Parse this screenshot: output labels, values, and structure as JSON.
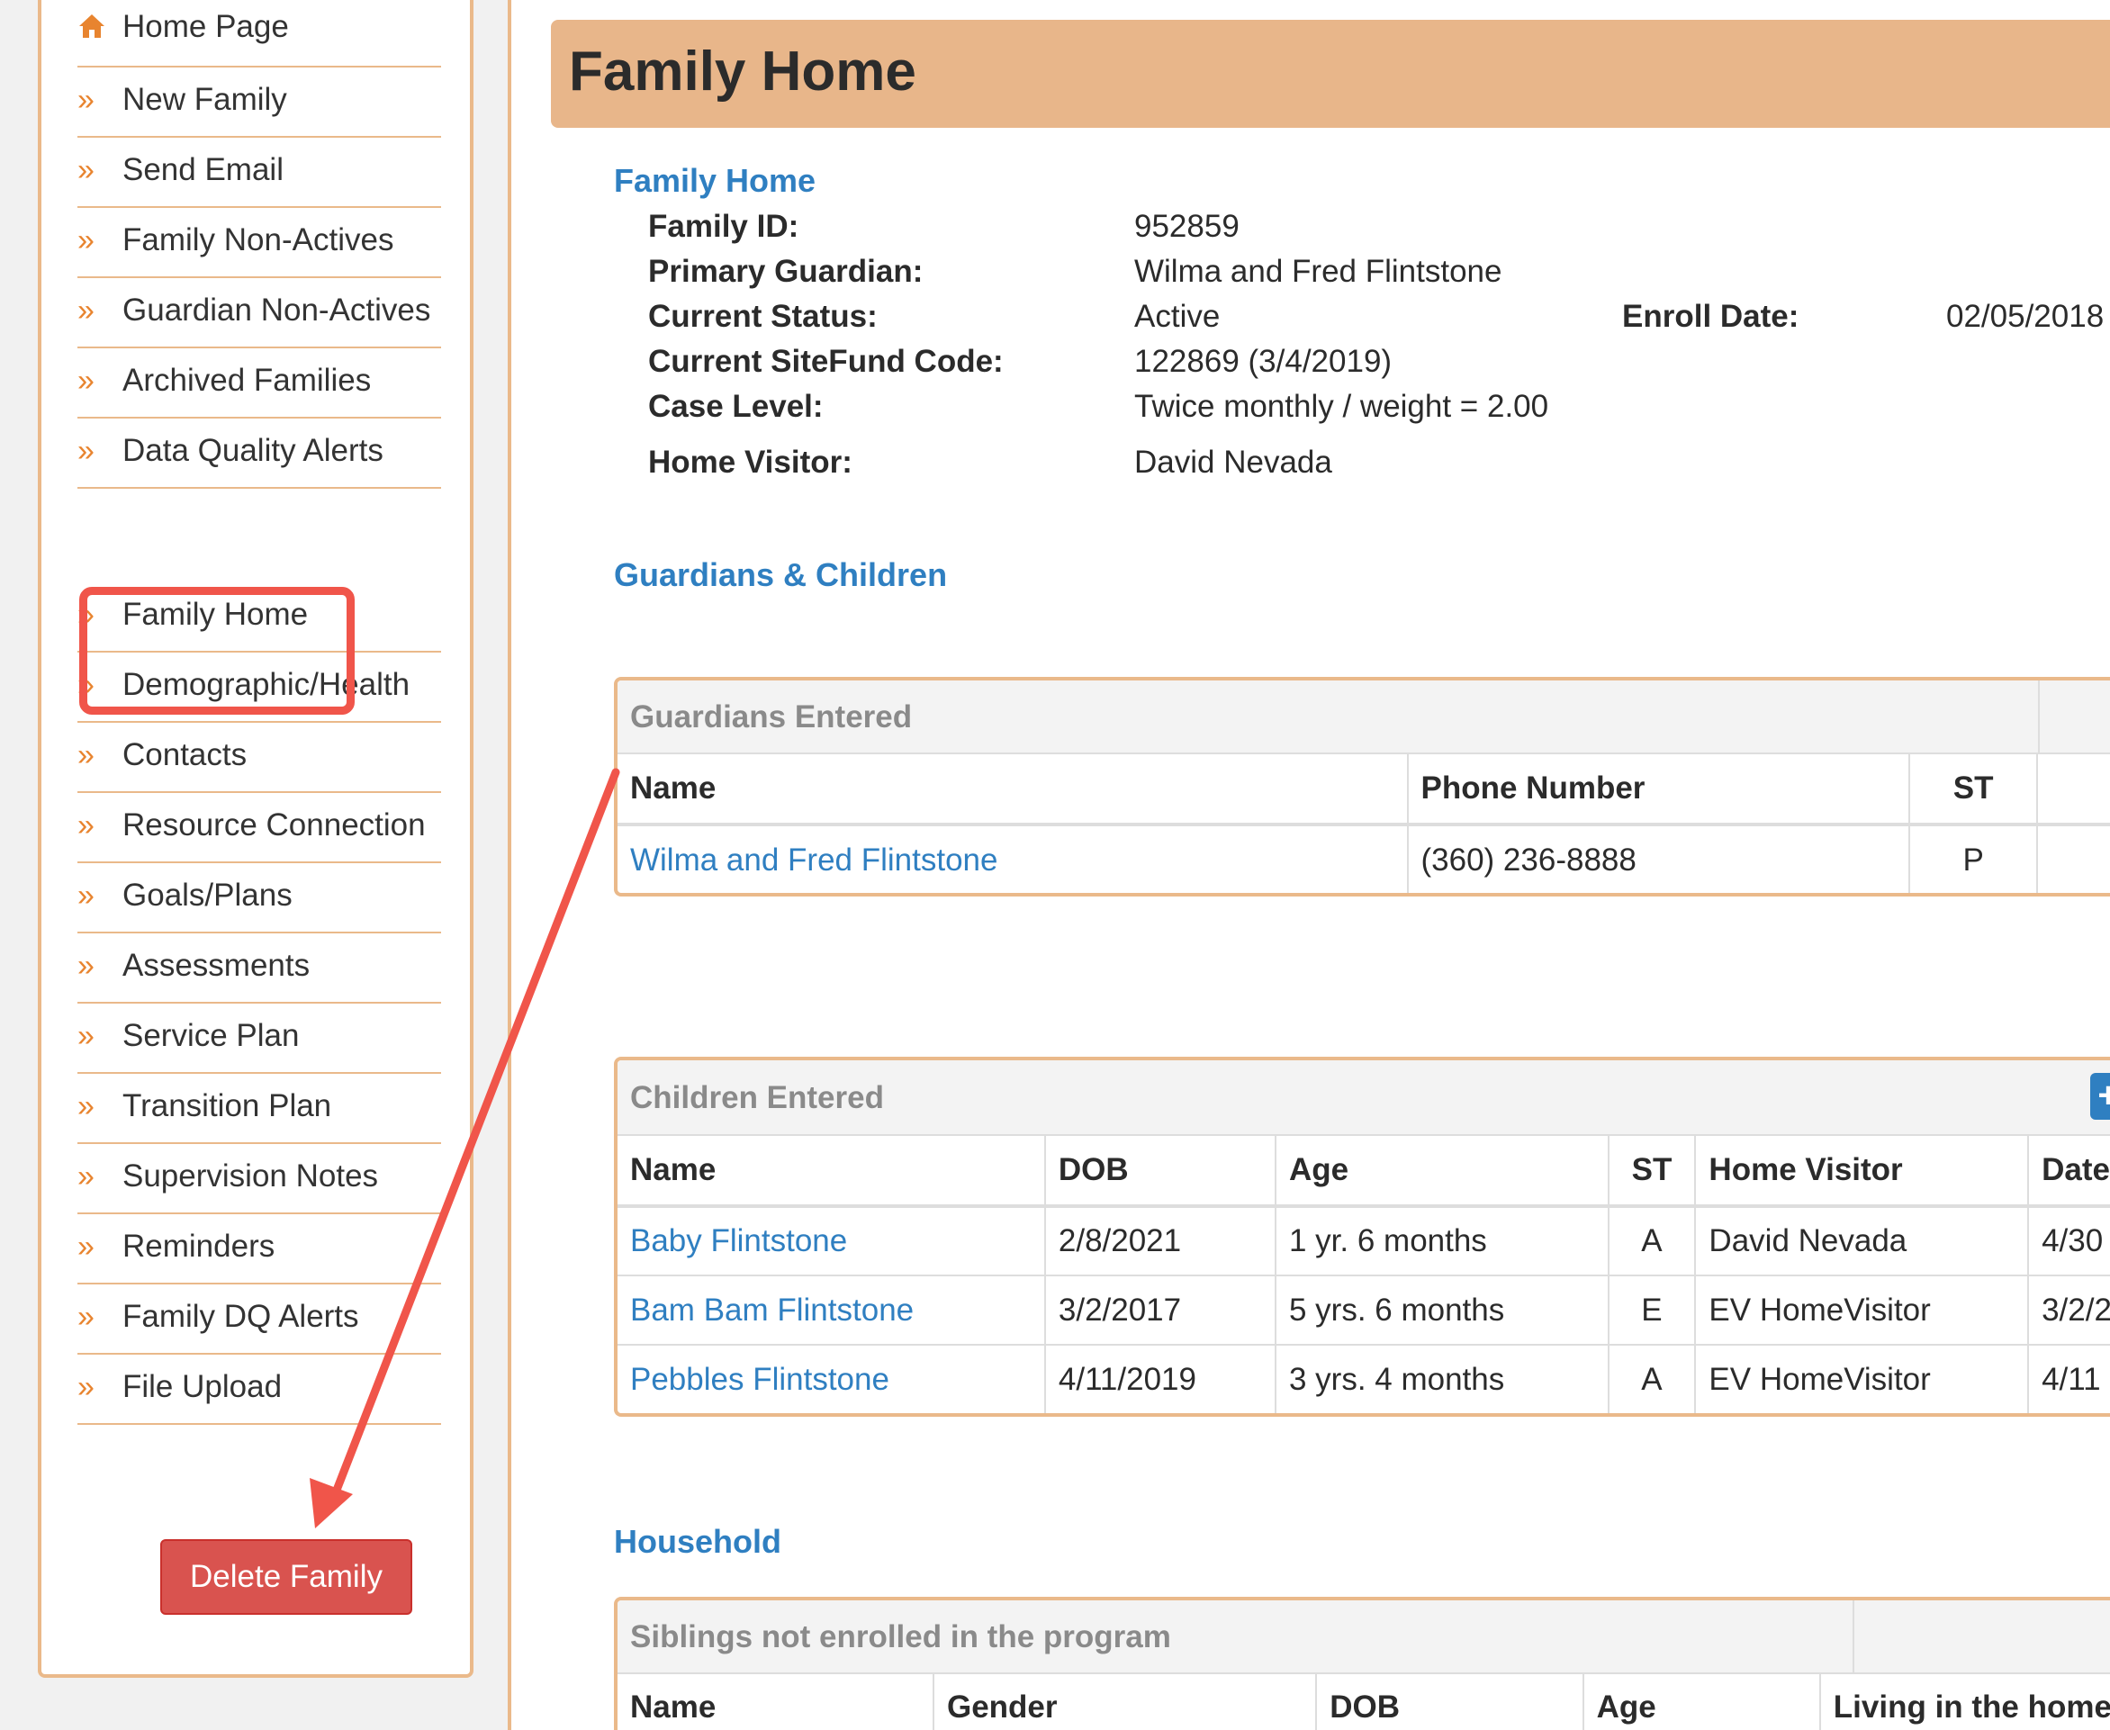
{
  "sidebar": {
    "items": [
      {
        "label": "Home Page",
        "icon": "home-icon"
      },
      {
        "label": "New Family",
        "icon": "chevron-right-icon"
      },
      {
        "label": "Send Email",
        "icon": "chevron-right-icon"
      },
      {
        "label": "Family Non-Actives",
        "icon": "chevron-right-icon"
      },
      {
        "label": "Guardian Non-Actives",
        "icon": "chevron-right-icon"
      },
      {
        "label": "Archived Families",
        "icon": "chevron-right-icon"
      },
      {
        "label": "Data Quality Alerts",
        "icon": "chevron-right-icon"
      }
    ],
    "family_items": [
      {
        "label": "Family Home"
      },
      {
        "label": "Demographic/Health"
      },
      {
        "label": "Contacts"
      },
      {
        "label": "Resource Connection"
      },
      {
        "label": "Goals/Plans"
      },
      {
        "label": "Assessments"
      },
      {
        "label": "Service Plan"
      },
      {
        "label": "Transition Plan"
      },
      {
        "label": "Supervision Notes"
      },
      {
        "label": "Reminders"
      },
      {
        "label": "Family DQ Alerts"
      },
      {
        "label": "File Upload"
      }
    ],
    "delete_label": "Delete Family"
  },
  "header": {
    "title": "Family Home"
  },
  "family_info": {
    "section_title": "Family Home",
    "family_id_label": "Family ID:",
    "family_id": "952859",
    "primary_guardian_label": "Primary Guardian:",
    "primary_guardian": "Wilma and Fred Flintstone",
    "current_status_label": "Current Status:",
    "current_status": "Active",
    "enroll_date_label": "Enroll Date:",
    "enroll_date": "02/05/2018",
    "sitefund_label": "Current SiteFund Code:",
    "sitefund": "122869 (3/4/2019)",
    "case_level_label": "Case Level:",
    "case_level": "Twice monthly / weight = 2.00",
    "home_visitor_label": "Home Visitor:",
    "home_visitor": "David Nevada"
  },
  "guardians_children": {
    "section_title": "Guardians & Children",
    "guardians": {
      "title": "Guardians Entered",
      "headers": [
        "Name",
        "Phone Number",
        "ST"
      ],
      "rows": [
        {
          "name": "Wilma and Fred Flintstone",
          "phone": "(360) 236-8888",
          "st": "P"
        }
      ]
    },
    "children": {
      "title": "Children Entered",
      "add_label": "+",
      "headers": [
        "Name",
        "DOB",
        "Age",
        "ST",
        "Home Visitor",
        "Date"
      ],
      "rows": [
        {
          "name": "Baby Flintstone",
          "dob": "2/8/2021",
          "age": "1 yr. 6 months",
          "st": "A",
          "visitor": "David Nevada",
          "date": "4/30"
        },
        {
          "name": "Bam Bam Flintstone",
          "dob": "3/2/2017",
          "age": "5 yrs. 6 months",
          "st": "E",
          "visitor": "EV HomeVisitor",
          "date": "3/2/2"
        },
        {
          "name": "Pebbles Flintstone",
          "dob": "4/11/2019",
          "age": "3 yrs. 4 months",
          "st": "A",
          "visitor": "EV HomeVisitor",
          "date": "4/11"
        }
      ]
    }
  },
  "household": {
    "section_title": "Household",
    "siblings": {
      "title": "Siblings not enrolled in the program",
      "headers": [
        "Name",
        "Gender",
        "DOB",
        "Age",
        "Living in the home"
      ]
    }
  },
  "colors": {
    "accent": "#e8842f",
    "border": "#eab98a",
    "header_bg": "#e8b68a",
    "link": "#2f7fc1",
    "danger": "#d9534f",
    "annotation": "#f0554a"
  }
}
